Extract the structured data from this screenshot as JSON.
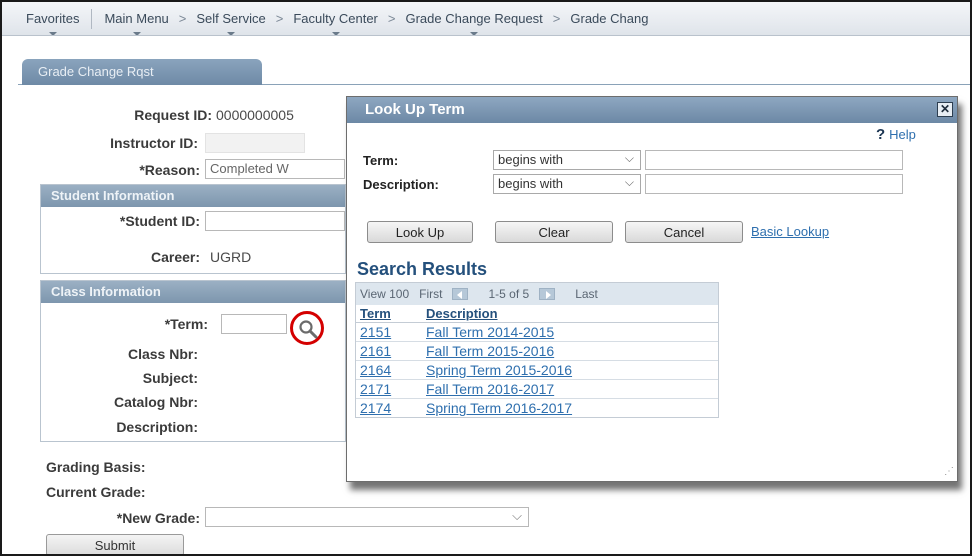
{
  "nav": {
    "favorites": "Favorites",
    "main_menu": "Main Menu",
    "sep": ">",
    "self_service": "Self Service",
    "faculty_center": "Faculty Center",
    "grade_change_request": "Grade Change Request",
    "grade_change": "Grade Chang"
  },
  "tab": {
    "label": "Grade Change Rqst"
  },
  "form": {
    "request_id_label": "Request ID:",
    "request_id_value": "0000000005",
    "instructor_id_label": "Instructor ID:",
    "reason_label": "*Reason:",
    "reason_value": "Completed W",
    "student_info_header": "Student Information",
    "student_id_label": "*Student ID:",
    "career_label": "Career:",
    "career_value": "UGRD",
    "class_info_header": "Class Information",
    "term_label": "*Term:",
    "class_nbr_label": "Class Nbr:",
    "subject_label": "Subject:",
    "catalog_nbr_label": "Catalog Nbr:",
    "description_label": "Description:",
    "grading_basis_label": "Grading Basis:",
    "current_grade_label": "Current Grade:",
    "new_grade_label": "*New Grade:",
    "submit_label": "Submit"
  },
  "modal": {
    "title": "Look Up Term",
    "close": "✕",
    "help": "Help",
    "help_glyph": "?",
    "term_label": "Term:",
    "description_label": "Description:",
    "operator": "begins with",
    "chevron": "⌵",
    "lookup_label": "Look Up",
    "clear_label": "Clear",
    "cancel_label": "Cancel",
    "basic_lookup_label": "Basic Lookup",
    "results_title": "Search Results",
    "grid_nav": {
      "view": "View 100",
      "first": "First",
      "range": "1-5 of 5",
      "last": "Last"
    },
    "columns": [
      "Term",
      "Description"
    ],
    "rows": [
      {
        "term": "2151",
        "description": "Fall Term 2014-2015"
      },
      {
        "term": "2161",
        "description": "Fall Term 2015-2016"
      },
      {
        "term": "2164",
        "description": "Spring Term 2015-2016"
      },
      {
        "term": "2171",
        "description": "Fall Term 2016-2017"
      },
      {
        "term": "2174",
        "description": "Spring Term 2016-2017"
      }
    ]
  },
  "colors": {
    "header_blue": "#7d96ae",
    "link_blue": "#2e6fae",
    "highlight_red": "#d40000"
  }
}
